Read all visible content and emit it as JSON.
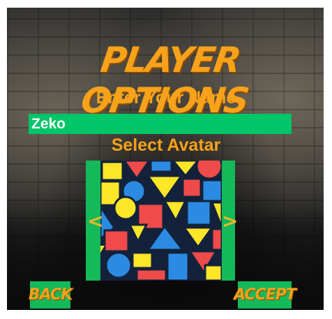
{
  "title": "PLAYER OPTIONS",
  "name_section": {
    "label": "Enter Your Name",
    "value": "Zeko"
  },
  "avatar_section": {
    "label": "Select Avatar",
    "prev_arrow": "<",
    "next_arrow": ">"
  },
  "buttons": {
    "back": "BACK",
    "accept": "ACCEPT"
  },
  "colors": {
    "title_orange": "#f6a21b",
    "panel_green": "#14b95a",
    "input_green": "#00c569",
    "avatar_yellow": "#fde528",
    "avatar_red": "#ef4b4b",
    "avatar_blue": "#2b8be3",
    "avatar_navy": "#13223a"
  },
  "icons": {
    "prev": "chevron-left-icon",
    "next": "chevron-right-icon"
  }
}
